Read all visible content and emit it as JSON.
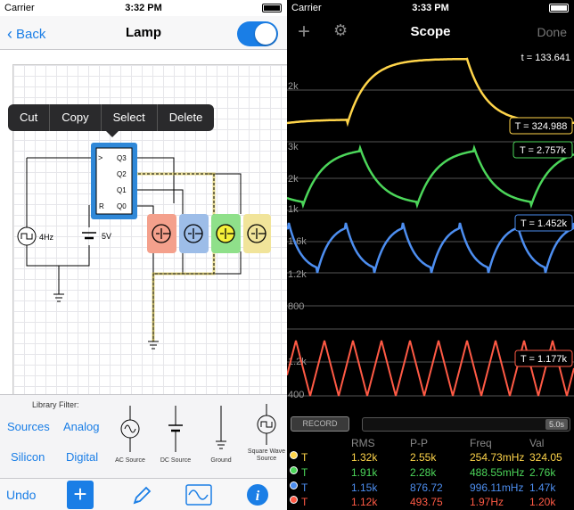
{
  "left": {
    "status": {
      "carrier": "Carrier",
      "time": "3:32 PM"
    },
    "nav": {
      "back_label": "Back",
      "title": "Lamp"
    },
    "edit_menu": [
      "Cut",
      "Copy",
      "Select",
      "Delete"
    ],
    "circuit": {
      "chip_pins": [
        "Q3",
        "Q2",
        "Q1",
        "Q0",
        "R"
      ],
      "chip_clock_mark": ">",
      "source_label": "4Hz",
      "battery_label": "5V"
    },
    "library": {
      "filter_title": "Library Filter:",
      "categories": [
        "Sources",
        "Analog",
        "Silicon",
        "Digital"
      ],
      "items": [
        {
          "label": "AC Source",
          "icon": "ac-source-icon"
        },
        {
          "label": "DC Source",
          "icon": "dc-source-icon"
        },
        {
          "label": "Ground",
          "icon": "ground-icon"
        },
        {
          "label": "Square Wave Source",
          "icon": "square-wave-source-icon"
        }
      ]
    },
    "toolbar": {
      "undo_label": "Undo",
      "add_label": "+"
    }
  },
  "right": {
    "status": {
      "carrier": "Carrier",
      "time": "3:33 PM"
    },
    "nav": {
      "title": "Scope",
      "done_label": "Done"
    },
    "scope": {
      "time_readout": "t = 133.641",
      "axis_labels": [
        "2k",
        "3k",
        "2k",
        "1k",
        "1.6k",
        "1.2k",
        "800",
        "1.2k",
        "400"
      ],
      "channels": [
        {
          "color": "#ffd54a",
          "trigger": "T = 324.988"
        },
        {
          "color": "#4cd65a",
          "trigger": "T = 2.757k"
        },
        {
          "color": "#4d8ef0",
          "trigger": "T = 1.452k"
        },
        {
          "color": "#ff5a45",
          "trigger": "T = 1.177k"
        }
      ]
    },
    "record": {
      "label": "RECORD",
      "duration": "5.0s"
    },
    "measurements": {
      "headers": [
        "RMS",
        "P-P",
        "Freq",
        "Val"
      ],
      "rows": [
        {
          "label": "T",
          "color": "#ffd54a",
          "rms": "1.32k",
          "pp": "2.55k",
          "freq": "254.73mHz",
          "val": "324.05"
        },
        {
          "label": "T",
          "color": "#4cd65a",
          "rms": "1.91k",
          "pp": "2.28k",
          "freq": "488.55mHz",
          "val": "2.76k"
        },
        {
          "label": "T",
          "color": "#4d8ef0",
          "rms": "1.15k",
          "pp": "876.72",
          "freq": "996.11mHz",
          "val": "1.47k"
        },
        {
          "label": "T",
          "color": "#ff5a45",
          "rms": "1.12k",
          "pp": "493.75",
          "freq": "1.97Hz",
          "val": "1.20k"
        }
      ]
    }
  }
}
